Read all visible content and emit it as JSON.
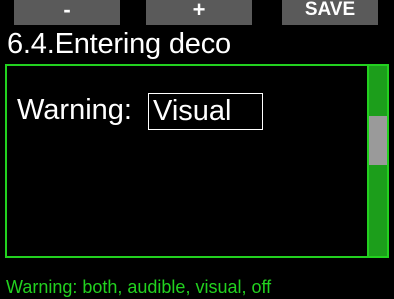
{
  "softkeys": {
    "left": "-",
    "middle": "+",
    "right": "SAVE"
  },
  "screen": {
    "title": "6.4.Entering deco"
  },
  "setting": {
    "label": "Warning:",
    "value": "Visual"
  },
  "hint": {
    "text": "Warning: both, audible, visual, off"
  },
  "colors": {
    "accent": "#22d11f",
    "softkey_bg": "#5a5a5a",
    "background": "#000000"
  }
}
